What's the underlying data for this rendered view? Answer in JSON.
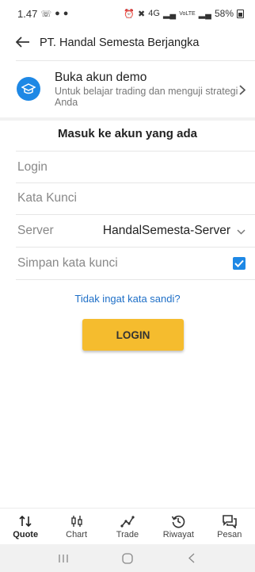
{
  "status_bar": {
    "time": "1.47",
    "signal_text": "4G",
    "lte_text": "VoLTE",
    "battery": "58%"
  },
  "app_bar": {
    "title": "PT. Handal Semesta Berjangka"
  },
  "demo": {
    "title": "Buka akun demo",
    "subtitle": "Untuk belajar trading dan menguji strategi Anda"
  },
  "form": {
    "section_title": "Masuk ke akun yang ada",
    "login_placeholder": "Login",
    "password_placeholder": "Kata Kunci",
    "server_label": "Server",
    "server_value": "HandalSemesta-Server",
    "save_password_label": "Simpan kata kunci",
    "save_password_checked": true,
    "forgot_link": "Tidak ingat kata sandi?",
    "login_button": "LOGIN"
  },
  "bottom_nav": {
    "items": [
      {
        "label": "Quote",
        "icon": "quote-arrows-icon",
        "active": true
      },
      {
        "label": "Chart",
        "icon": "candlestick-icon",
        "active": false
      },
      {
        "label": "Trade",
        "icon": "trend-line-icon",
        "active": false
      },
      {
        "label": "Riwayat",
        "icon": "history-icon",
        "active": false
      },
      {
        "label": "Pesan",
        "icon": "chat-bubbles-icon",
        "active": false
      }
    ]
  },
  "colors": {
    "accent_blue": "#1e88e5",
    "link_blue": "#1e6fc7",
    "login_yellow": "#f5bc2e"
  }
}
